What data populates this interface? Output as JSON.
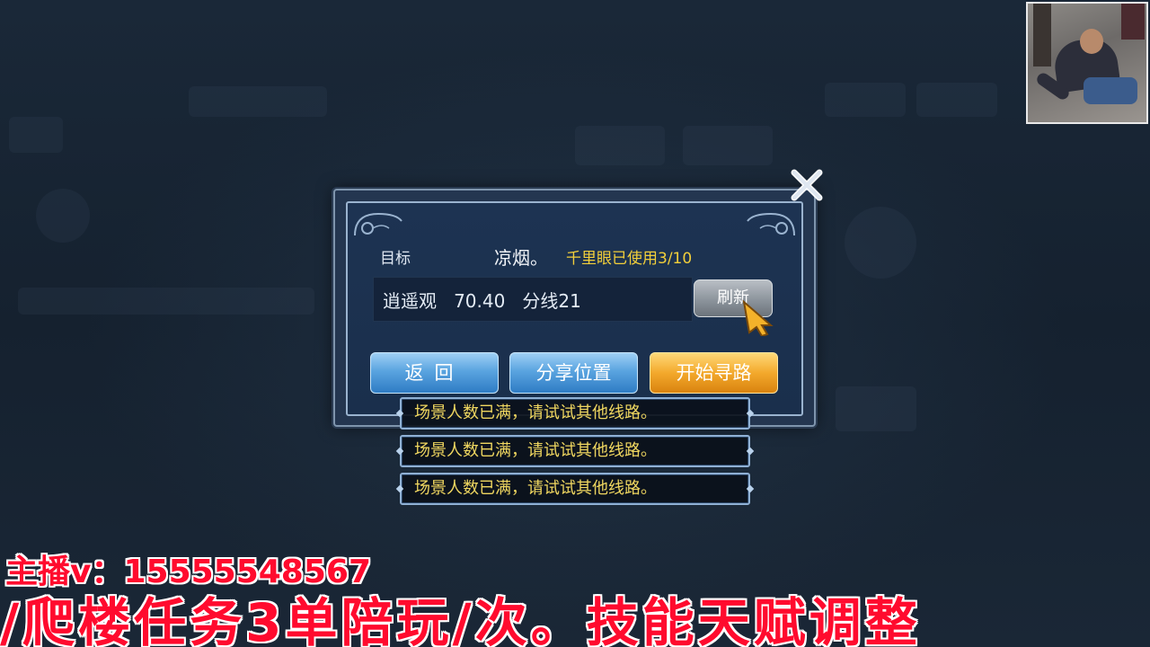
{
  "dialog": {
    "target_label": "目标",
    "target_name": "凉烟。",
    "usage_text": "千里眼已使用3/10",
    "location_text": "逍遥观   70.40   分线21",
    "refresh_label": "刷新",
    "buttons": {
      "back": "返回",
      "share": "分享位置",
      "start": "开始寻路"
    }
  },
  "toasts": [
    "场景人数已满，请试试其他线路。",
    "场景人数已满，请试试其他线路。",
    "场景人数已满，请试试其他线路。"
  ],
  "overlay": {
    "contact": "主播v：15555548567",
    "services": "/爬楼任务3单陪玩/次。技能天赋调整"
  },
  "colors": {
    "usage_text": "#f2cf3a",
    "toast_text": "#f0d760",
    "overlay_text": "#ff0b2e",
    "button_blue": "#5aa4e0",
    "button_orange": "#f3a92c"
  },
  "icons": {
    "close": "close-icon",
    "cursor": "pointer-cursor-icon"
  }
}
